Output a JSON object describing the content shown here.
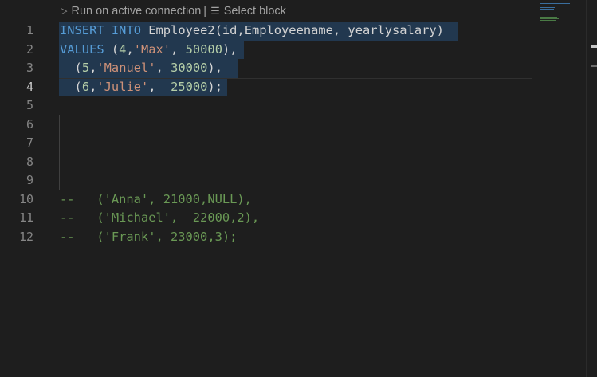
{
  "codelens": {
    "run_label": "Run on active connection",
    "separator": "|",
    "select_label": "Select block",
    "run_icon": "play-icon",
    "select_icon": "lines-icon"
  },
  "editor": {
    "line_numbers": [
      "1",
      "2",
      "3",
      "4",
      "5",
      "6",
      "7",
      "8",
      "9",
      "10",
      "11",
      "12"
    ],
    "active_line": "4",
    "lines": {
      "l1": {
        "kw1": "INSERT",
        "kw2": "INTO",
        "rest": "Employee2(id,Employeename, yearlysalary)"
      },
      "l2": {
        "kw": "VALUES",
        "p1": "(",
        "n1": "4",
        "c1": ",",
        "s1": "'Max'",
        "c2": ", ",
        "n2": "50000",
        "p2": "),"
      },
      "l3": {
        "p1": "(",
        "n1": "5",
        "c1": ",",
        "s1": "'Manuel'",
        "c2": ", ",
        "n2": "30000",
        "p2": "),"
      },
      "l4": {
        "p1": "(",
        "n1": "6",
        "c1": ",",
        "s1": "'Julie'",
        "c2": ",  ",
        "n2": "25000",
        "p2": ");"
      },
      "l10": "--   ('Anna', 21000,NULL),",
      "l11": "--   ('Michael',  22000,2),",
      "l12": "--   ('Frank', 23000,3);"
    }
  },
  "colors": {
    "background": "#1e1e1e",
    "keyword": "#569cd6",
    "string": "#ce9178",
    "number": "#b5cea8",
    "comment": "#6a9955",
    "selection": "#264f78"
  }
}
